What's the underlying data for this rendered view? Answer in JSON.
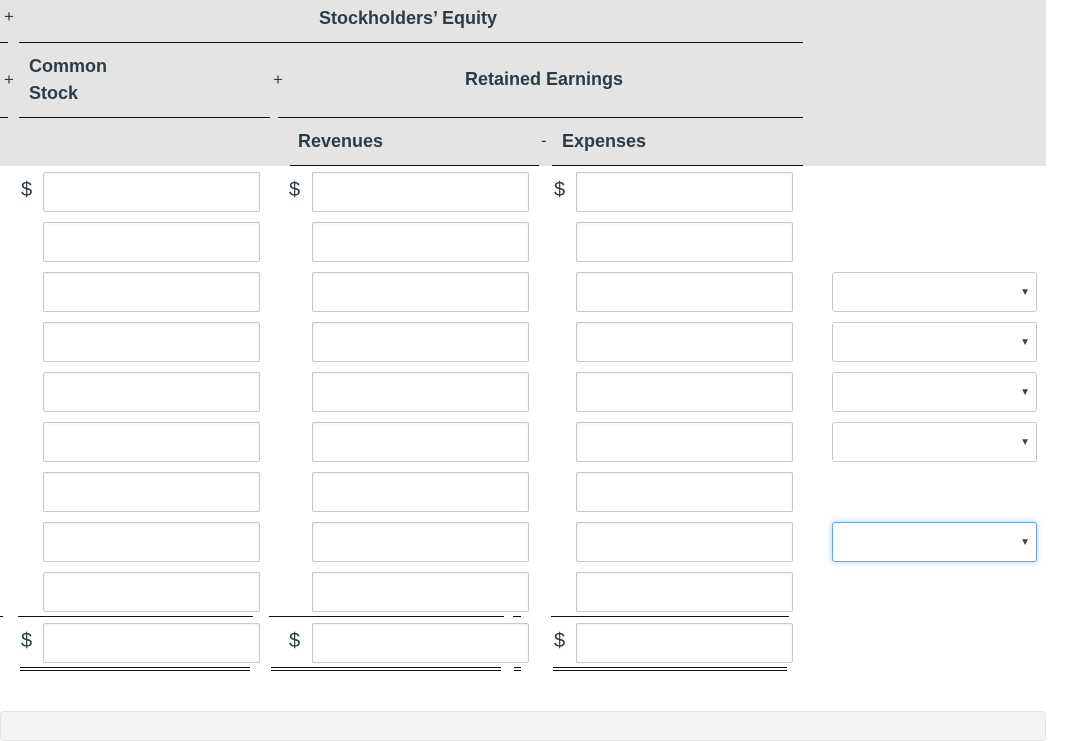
{
  "header": {
    "stockholders_equity": "Stockholders’ Equity",
    "common_stock_line1": "Common",
    "common_stock_line2": "Stock",
    "retained_earnings": "Retained Earnings",
    "revenues": "Revenues",
    "expenses": "Expenses",
    "op_plus": "+",
    "op_minus": "-"
  },
  "currency_symbol": "$",
  "dropdown_caret": "▼",
  "columns": [
    "Common Stock",
    "Revenues",
    "Expenses"
  ],
  "rows": [
    {
      "common_stock": "",
      "revenues": "",
      "expenses": "",
      "has_select": false
    },
    {
      "common_stock": "",
      "revenues": "",
      "expenses": "",
      "has_select": false
    },
    {
      "common_stock": "",
      "revenues": "",
      "expenses": "",
      "has_select": true,
      "select_value": ""
    },
    {
      "common_stock": "",
      "revenues": "",
      "expenses": "",
      "has_select": true,
      "select_value": ""
    },
    {
      "common_stock": "",
      "revenues": "",
      "expenses": "",
      "has_select": true,
      "select_value": ""
    },
    {
      "common_stock": "",
      "revenues": "",
      "expenses": "",
      "has_select": true,
      "select_value": ""
    },
    {
      "common_stock": "",
      "revenues": "",
      "expenses": "",
      "has_select": false
    },
    {
      "common_stock": "",
      "revenues": "",
      "expenses": "",
      "has_select": true,
      "select_value": "",
      "focused": true
    },
    {
      "common_stock": "",
      "revenues": "",
      "expenses": "",
      "has_select": false
    }
  ],
  "totals": {
    "common_stock": "",
    "revenues": "",
    "expenses": ""
  }
}
